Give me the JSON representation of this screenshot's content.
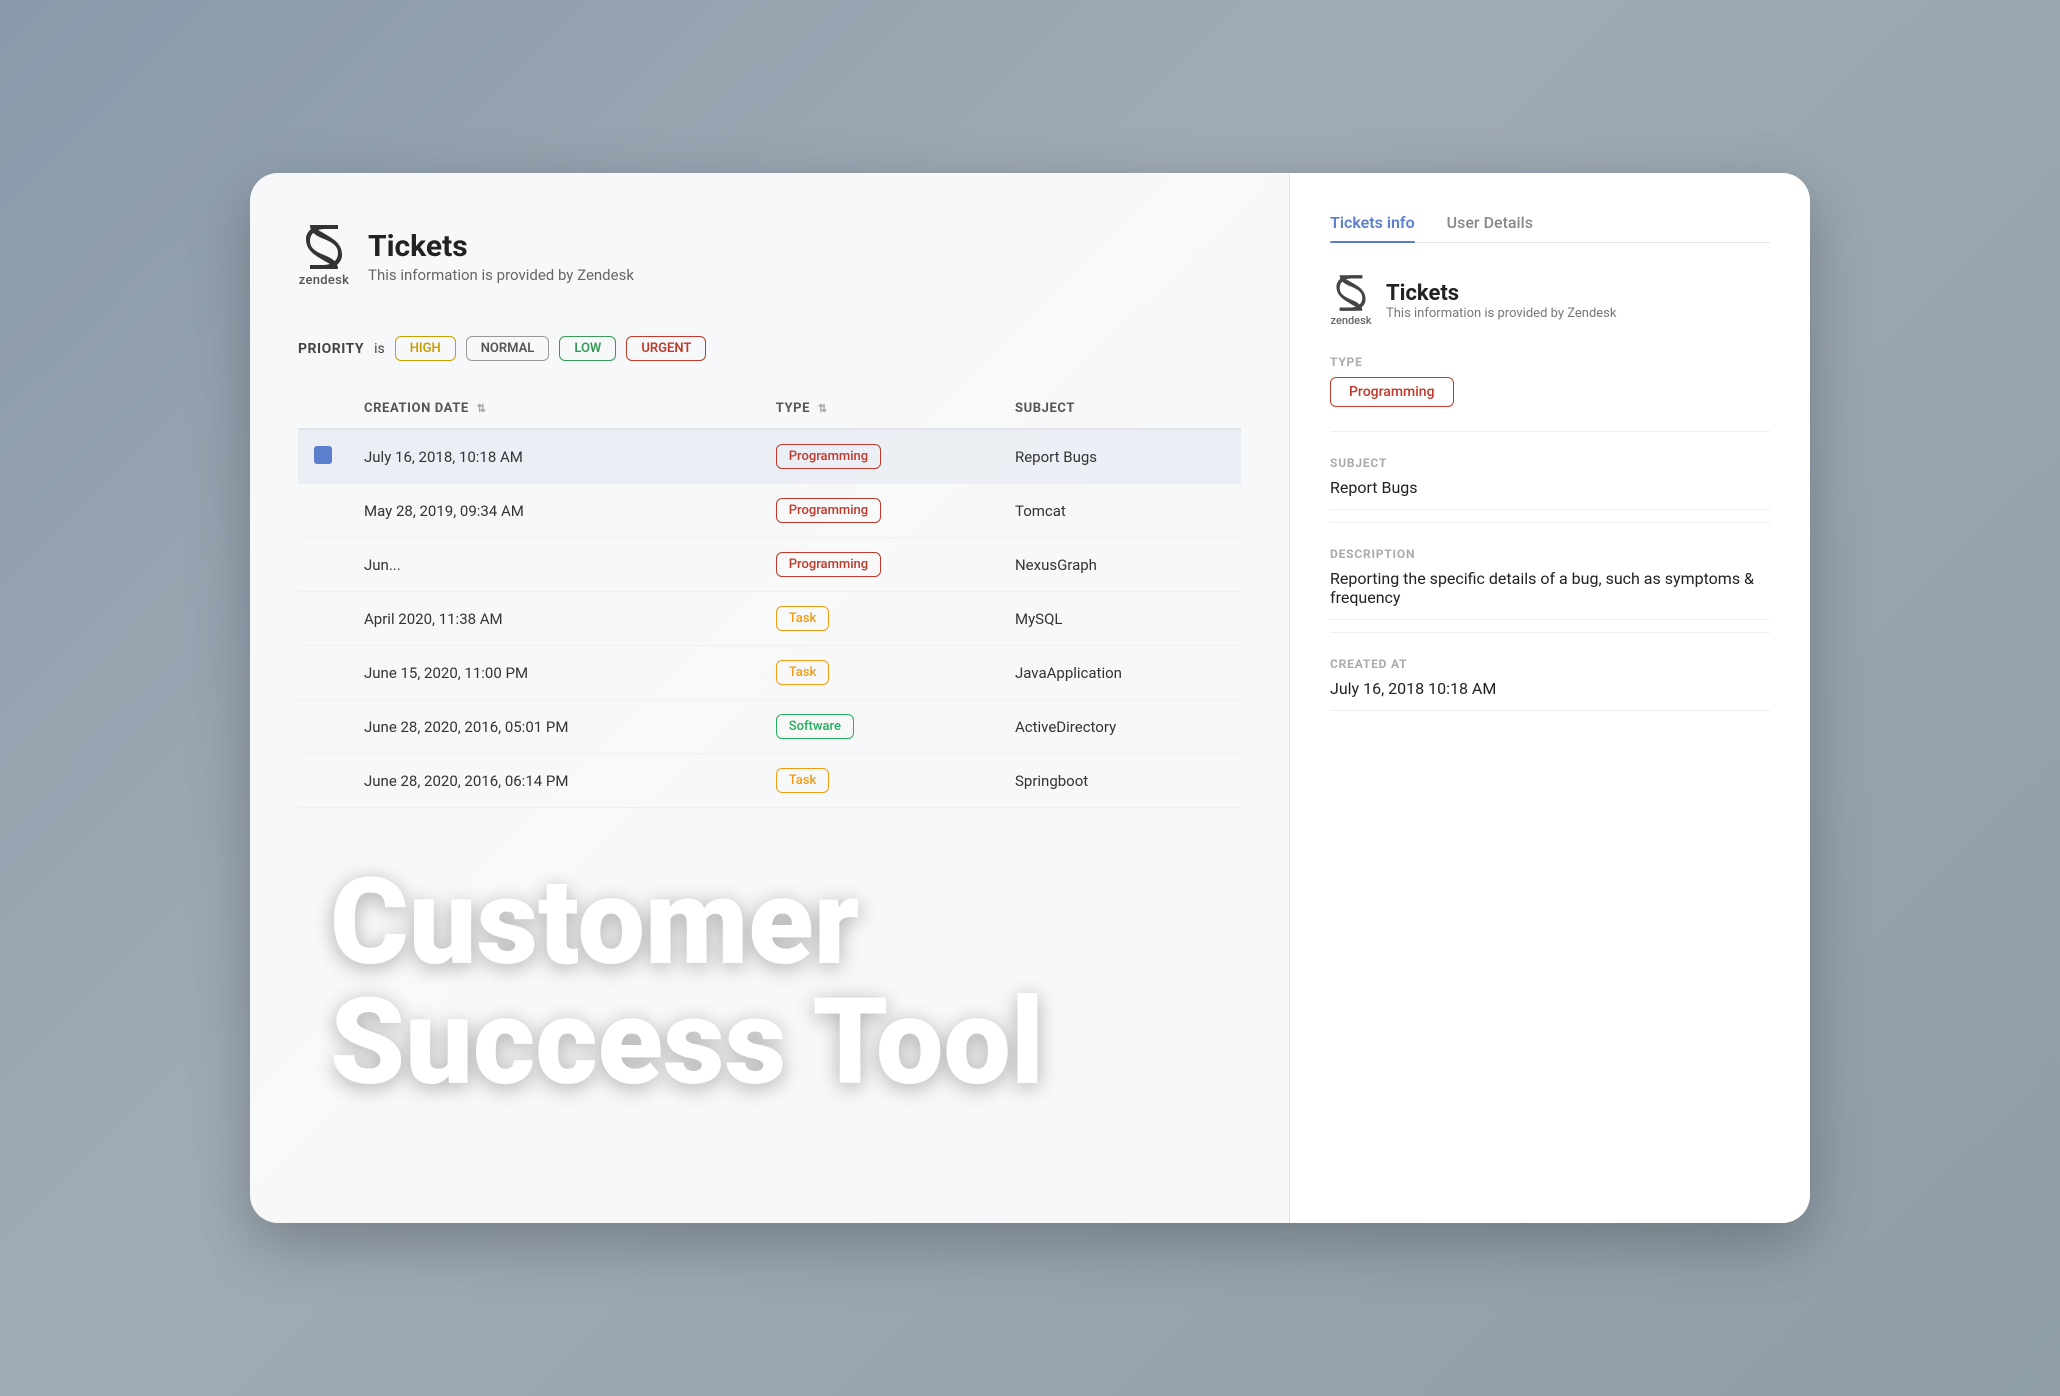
{
  "app": {
    "title": "Tickets",
    "subtitle": "This information is provided by Zendesk",
    "zendesk_label": "zendesk"
  },
  "priority_filter": {
    "label": "PRIORITY",
    "is_text": "is",
    "badges": [
      "HIGH",
      "NORMAL",
      "LOW",
      "URGENT"
    ]
  },
  "table": {
    "columns": [
      "CREATION DATE",
      "TYPE",
      "SUBJECT"
    ],
    "rows": [
      {
        "date": "July 16, 2018, 10:18 AM",
        "type": "Programming",
        "subject": "Report Bugs",
        "selected": true
      },
      {
        "date": "May 28, 2019, 09:34 AM",
        "type": "Programming",
        "subject": "Tomcat",
        "selected": false
      },
      {
        "date": "Jun...",
        "type": "Programming",
        "subject": "NexusGraph",
        "selected": false
      },
      {
        "date": "April 2020, 11:38 AM",
        "type": "Task",
        "subject": "MySQL",
        "selected": false
      },
      {
        "date": "June 15, 2020, 11:00 PM",
        "type": "Task",
        "subject": "JavaApplication",
        "selected": false
      },
      {
        "date": "June 28, 2020, 2016, 05:01 PM",
        "type": "Software",
        "subject": "ActiveDirectory",
        "selected": false
      },
      {
        "date": "June 28, 2020, 2016, 06:14 PM",
        "type": "Task",
        "subject": "Springboot",
        "selected": false
      }
    ]
  },
  "overlay": {
    "line1": "Customer",
    "line2": "Success Tool"
  },
  "right_panel": {
    "tabs": [
      "Tickets info",
      "User Details"
    ],
    "active_tab": "Tickets info",
    "app_title": "Tickets",
    "app_subtitle": "This information is provided by Zendesk",
    "zendesk_label": "zendesk",
    "sections": [
      {
        "label": "TYPE",
        "value": "Programming",
        "is_type": true
      },
      {
        "label": "SUBJECT",
        "value": "Report Bugs",
        "is_type": false
      },
      {
        "label": "DESCRIPTION",
        "value": "Reporting the specific details of a bug, such as symptoms & frequency",
        "is_type": false
      },
      {
        "label": "CREATED AT",
        "value": "July 16, 2018 10:18 AM",
        "is_type": false
      }
    ]
  }
}
